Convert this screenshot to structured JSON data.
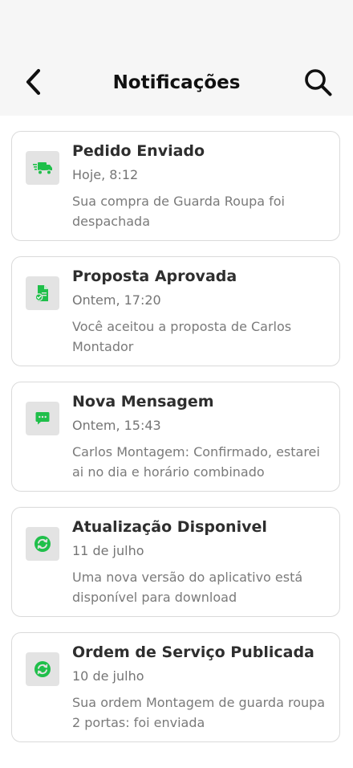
{
  "header": {
    "title": "Notificações",
    "back_icon": "chevron-left-icon",
    "search_icon": "search-icon"
  },
  "colors": {
    "accent": "#1fbf4a",
    "header_bg": "#f6f6f6",
    "icon_bg": "#e3e3e3"
  },
  "notifications": [
    {
      "title": "Pedido Enviado",
      "time": "Hoje, 8:12",
      "description": "Sua compra de Guarda Roupa foi despachada",
      "icon": "truck-icon"
    },
    {
      "title": "Proposta Aprovada",
      "time": "Ontem, 17:20",
      "description": "Você aceitou a proposta de Carlos Montador",
      "icon": "document-check-icon"
    },
    {
      "title": "Nova Mensagem",
      "time": "Ontem, 15:43",
      "description": "Carlos Montagem: Confirmado, estarei ai no dia e horário combinado",
      "icon": "chat-icon"
    },
    {
      "title": "Atualização Disponivel",
      "time": "11 de julho",
      "description": "Uma nova versão do aplicativo está disponível para download",
      "icon": "refresh-icon"
    },
    {
      "title": "Ordem de Serviço Publicada",
      "time": "10 de julho",
      "description": "Sua ordem Montagem de guarda roupa 2 portas: foi enviada",
      "icon": "refresh-icon"
    }
  ]
}
